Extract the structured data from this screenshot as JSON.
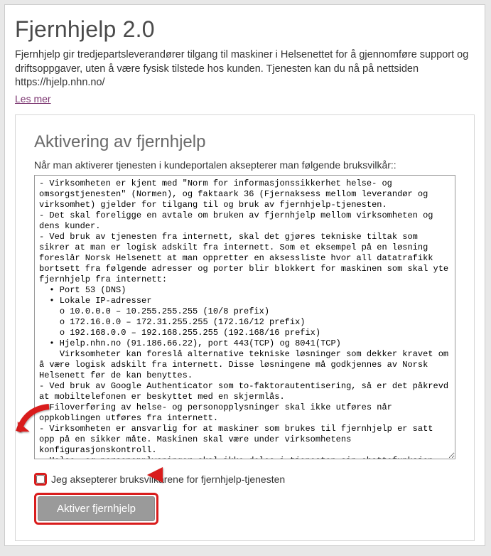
{
  "page": {
    "title": "Fjernhjelp 2.0",
    "intro": "Fjernhjelp gir tredjepartsleverandører tilgang til maskiner i Helsenettet for å gjennomføre support og driftsoppgaver, uten å være fysisk tilstede hos kunden. Tjenesten kan du nå på nettsiden https://hjelp.nhn.no/",
    "readmore": "Les mer"
  },
  "card": {
    "heading": "Aktivering av fjernhjelp",
    "subheading": "Når man aktiverer tjenesten i kundeportalen aksepterer man følgende bruksvilkår::",
    "terms": "- Virksomheten er kjent med \"Norm for informasjonssikkerhet helse- og omsorgstjenesten\" (Normen), og faktaark 36 (Fjernaksess mellom leverandør og virksomhet) gjelder for tilgang til og bruk av fjernhjelp-tjenesten.\n- Det skal foreligge en avtale om bruken av fjernhjelp mellom virksomheten og dens kunder.\n- Ved bruk av tjenesten fra internett, skal det gjøres tekniske tiltak som sikrer at man er logisk adskilt fra internett. Som et eksempel på en løsning foreslår Norsk Helsenett at man oppretter en aksessliste hvor all datatrafikk bortsett fra følgende adresser og porter blir blokkert for maskinen som skal yte fjernhjelp fra internett:\n  • Port 53 (DNS)\n  • Lokale IP-adresser\n    o 10.0.0.0 – 10.255.255.255 (10/8 prefix)\n    o 172.16.0.0 – 172.31.255.255 (172.16/12 prefix)\n    o 192.168.0.0 – 192.168.255.255 (192.168/16 prefix)\n  • Hjelp.nhn.no (91.186.66.22), port 443(TCP) og 8041(TCP)\n    Virksomheter kan foreslå alternative tekniske løsninger som dekker kravet om å være logisk adskilt fra internett. Disse løsningene må godkjennes av Norsk Helsenett før de kan benyttes.\n- Ved bruk av Google Authenticator som to-faktorautentisering, så er det påkrevd at mobiltelefonen er beskyttet med en skjermlås.\n- Filoverføring av helse- og personopplysninger skal ikke utføres når oppkoblingen utføres fra internett.\n- Virksomheten er ansvarlig for at maskiner som brukes til fjernhjelp er satt opp på en sikker måte. Maskinen skal være under virksomhetens konfigurasjonskontroll.\n- Helse- og personopplysninger skal ikke deles i tjenesten sin chattefunksjon.",
    "accept_label": "Jeg aksepterer bruksvilkårene for fjernhjelp-tjenesten",
    "button_label": "Aktiver fjernhjelp"
  },
  "annotations": {
    "arrow_color": "#d91c1c"
  }
}
